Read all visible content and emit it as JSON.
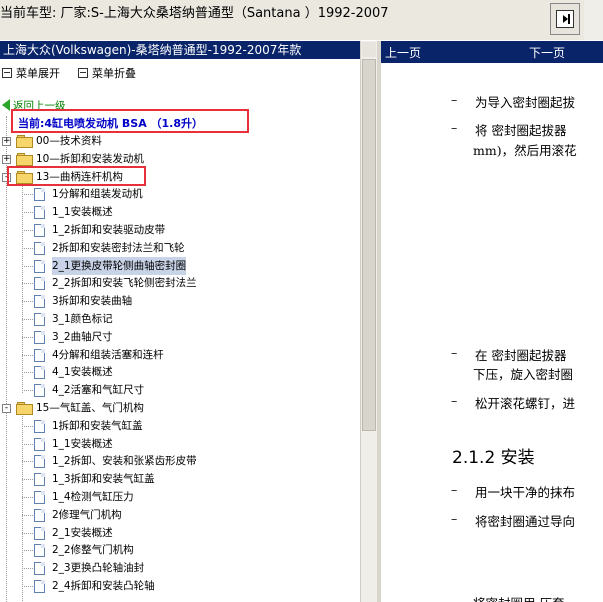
{
  "topbar": {
    "title": "当前车型:  厂家:S-上海大众桑塔纳普通型（Santana ）1992-2007"
  },
  "left": {
    "header": "上海大众(Volkswagen)-桑塔纳普通型-1992-2007年款",
    "menu": {
      "expand": "菜单展开",
      "collapse": "菜单折叠"
    },
    "back": "返回上一级",
    "current": "当前:4缸电喷发动机 BSA （1.8升）",
    "tree": [
      {
        "label": "00—技术资料",
        "level": 0,
        "type": "folder",
        "exp": "+"
      },
      {
        "label": "10—拆卸和安装发动机",
        "level": 0,
        "type": "folder",
        "exp": "+"
      },
      {
        "label": "13—曲柄连杆机构",
        "level": 0,
        "type": "folder",
        "exp": "-"
      },
      {
        "label": "1分解和组装发动机",
        "level": 1,
        "type": "doc"
      },
      {
        "label": "1_1安装概述",
        "level": 1,
        "type": "doc"
      },
      {
        "label": "1_2拆卸和安装驱动皮带",
        "level": 1,
        "type": "doc"
      },
      {
        "label": "2拆卸和安装密封法兰和飞轮",
        "level": 1,
        "type": "doc"
      },
      {
        "label": "2_1更换皮带轮侧曲轴密封圈",
        "level": 1,
        "type": "doc",
        "sel": true
      },
      {
        "label": "2_2拆卸和安装飞轮侧密封法兰",
        "level": 1,
        "type": "doc"
      },
      {
        "label": "3拆卸和安装曲轴",
        "level": 1,
        "type": "doc"
      },
      {
        "label": "3_1颜色标记",
        "level": 1,
        "type": "doc"
      },
      {
        "label": "3_2曲轴尺寸",
        "level": 1,
        "type": "doc"
      },
      {
        "label": "4分解和组装活塞和连杆",
        "level": 1,
        "type": "doc"
      },
      {
        "label": "4_1安装概述",
        "level": 1,
        "type": "doc"
      },
      {
        "label": "4_2活塞和气缸尺寸",
        "level": 1,
        "type": "doc"
      },
      {
        "label": "15—气缸盖、气门机构",
        "level": 0,
        "type": "folder",
        "exp": "-"
      },
      {
        "label": "1拆卸和安装气缸盖",
        "level": 1,
        "type": "doc"
      },
      {
        "label": "1_1安装概述",
        "level": 1,
        "type": "doc"
      },
      {
        "label": "1_2拆卸、安装和张紧齿形皮带",
        "level": 1,
        "type": "doc"
      },
      {
        "label": "1_3拆卸和安装气缸盖",
        "level": 1,
        "type": "doc"
      },
      {
        "label": "1_4检测气缸压力",
        "level": 1,
        "type": "doc"
      },
      {
        "label": "2修理气门机构",
        "level": 1,
        "type": "doc"
      },
      {
        "label": "2_1安装概述",
        "level": 1,
        "type": "doc"
      },
      {
        "label": "2_2修整气门机构",
        "level": 1,
        "type": "doc"
      },
      {
        "label": "2_3更换凸轮轴油封",
        "level": 1,
        "type": "doc"
      },
      {
        "label": "2_4拆卸和安装凸轮轴",
        "level": 1,
        "type": "doc"
      }
    ]
  },
  "right": {
    "prev": "上一页",
    "next": "下一页",
    "lines": [
      {
        "dash": "–",
        "text": "为导入密封圈起拔"
      },
      {
        "dash": "–",
        "text": "将 密封圈起拔器"
      },
      {
        "dash": "",
        "text": "mm)，然后用滚花"
      },
      {
        "dash": "–",
        "text": "在 密封圈起拔器"
      },
      {
        "dash": "",
        "text": "下压，旋入密封圈"
      },
      {
        "dash": "–",
        "text": "松开滚花螺钉，进"
      },
      {
        "dash": "–",
        "text": "用一块干净的抹布"
      },
      {
        "dash": "–",
        "text": "将密封圈通过导向"
      }
    ],
    "heading": "2.1.2 安装",
    "bottom_text": "将密封圈用 压套"
  },
  "colors": {
    "header_bg": "#0a246a",
    "highlight": "#e8303a",
    "current_text": "#0000c8",
    "back_text": "#008000"
  }
}
